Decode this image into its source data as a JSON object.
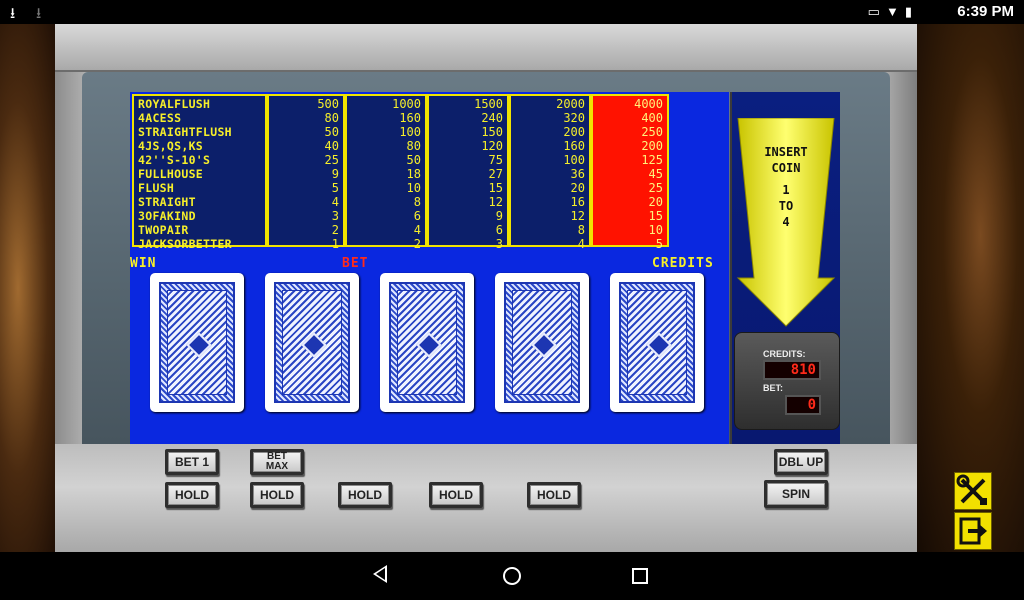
{
  "status_bar": {
    "time": "6:39 PM",
    "left_icons": [
      "download-icon",
      "download-icon"
    ],
    "right_icons": [
      "cast-icon",
      "wifi-icon",
      "battery-icon"
    ]
  },
  "paytable": {
    "hands": [
      "ROYALFLUSH",
      "4ACESS",
      "STRAIGHTFLUSH",
      "4JS,QS,KS",
      "42''S-10'S",
      "FULLHOUSE",
      "FLUSH",
      "STRAIGHT",
      "3OFAKIND",
      "TWOPAIR",
      "JACKSORBETTER"
    ],
    "columns": [
      [
        "500",
        "80",
        "50",
        "40",
        "25",
        "9",
        "5",
        "4",
        "3",
        "2",
        "1"
      ],
      [
        "1000",
        "160",
        "100",
        "80",
        "50",
        "18",
        "10",
        "8",
        "6",
        "4",
        "2"
      ],
      [
        "1500",
        "240",
        "150",
        "120",
        "75",
        "27",
        "15",
        "12",
        "9",
        "6",
        "3"
      ],
      [
        "2000",
        "320",
        "200",
        "160",
        "100",
        "36",
        "20",
        "16",
        "12",
        "8",
        "4"
      ],
      [
        "4000",
        "400",
        "250",
        "200",
        "125",
        "45",
        "25",
        "20",
        "15",
        "10",
        "5"
      ]
    ],
    "highlight_color": "#ff1200"
  },
  "labels": {
    "win": "WIN",
    "bet": "BET",
    "credits": "CREDITS"
  },
  "insert_coin": {
    "line1": "INSERT",
    "line2": "COIN",
    "line3": "1",
    "line4": "TO",
    "line5": "4"
  },
  "meters": {
    "credits_label": "CREDITS:",
    "credits_value": "810",
    "bet_label": "BET:",
    "bet_value": "0"
  },
  "buttons": {
    "bet1": "BET 1",
    "betmax_line1": "BET",
    "betmax_line2": "MAX",
    "hold": "HOLD",
    "dbl_up": "DBL UP",
    "spin": "SPIN"
  },
  "colors": {
    "screen_blue": "#0a28e0",
    "paytable_yellow": "#f6ef2a",
    "side_button_yellow": "#f2e000"
  }
}
